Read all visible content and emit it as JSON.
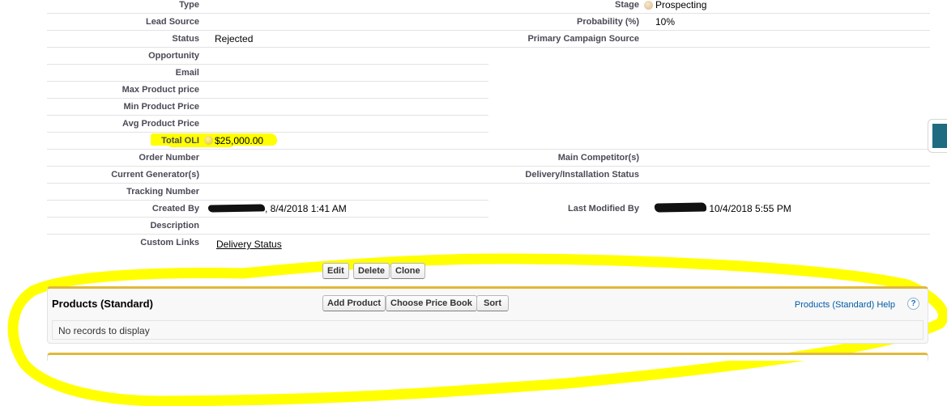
{
  "record": {
    "left_fields": [
      {
        "label": "Type",
        "value": ""
      },
      {
        "label": "Lead Source",
        "value": ""
      },
      {
        "label": "Status",
        "value": "Rejected"
      },
      {
        "label": "Opportunity",
        "value": ""
      },
      {
        "label": "Email",
        "value": ""
      },
      {
        "label": "Max Product price",
        "value": ""
      },
      {
        "label": "Min Product Price",
        "value": ""
      },
      {
        "label": "Avg Product Price",
        "value": ""
      },
      {
        "label": "Total OLI",
        "value": "$25,000.00",
        "help_icon": "help-orb-icon",
        "highlighted": true
      },
      {
        "label": "Order Number",
        "value": ""
      },
      {
        "label": "Current Generator(s)",
        "value": ""
      },
      {
        "label": "Tracking Number",
        "value": ""
      },
      {
        "label": "Created By",
        "value": ", 8/4/2018 1:41 AM",
        "redacted_name": true
      },
      {
        "label": "Description",
        "value": ""
      },
      {
        "label": "Custom Links",
        "value": "Delivery Status",
        "is_link": true
      }
    ],
    "right_fields": [
      {
        "label": "Stage",
        "value": "Prospecting",
        "help_icon": "help-orb-icon"
      },
      {
        "label": "Probability (%)",
        "value": "10%"
      },
      {
        "label": "Primary Campaign Source",
        "value": ""
      },
      {
        "label": "Main Competitor(s)",
        "value": ""
      },
      {
        "label": "Delivery/Installation Status",
        "value": ""
      },
      {
        "label": "Last Modified By",
        "value": " 10/4/2018 5:55 PM",
        "redacted_name": true
      }
    ]
  },
  "actions": {
    "edit": "Edit",
    "delete": "Delete",
    "clone": "Clone"
  },
  "products": {
    "title": "Products (Standard)",
    "add_product": "Add Product",
    "choose_price_book": "Choose Price Book",
    "sort": "Sort",
    "help_link": "Products (Standard) Help",
    "help_icon": "?",
    "empty_message": "No records to display"
  },
  "colors": {
    "section_accent": "#e1b83a",
    "highlighter": "#ffff00",
    "help_link": "#015ba7",
    "side_tab": "#1f6b80"
  }
}
